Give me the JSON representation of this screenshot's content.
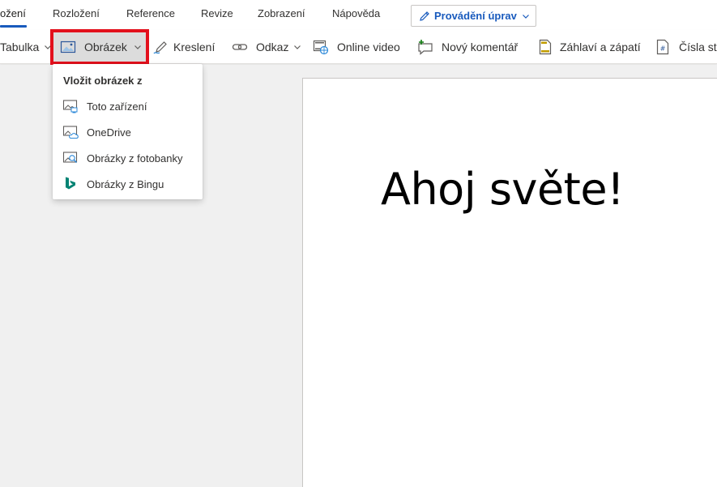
{
  "tabs": [
    {
      "label": "ožení"
    },
    {
      "label": "Rozložení"
    },
    {
      "label": "Reference"
    },
    {
      "label": "Revize"
    },
    {
      "label": "Zobrazení"
    },
    {
      "label": "Nápověda"
    }
  ],
  "edit_mode": {
    "label": "Provádění úprav"
  },
  "ribbon": {
    "tabulka": "Tabulka",
    "obrazek": "Obrázek",
    "kresleni": "Kreslení",
    "odkaz": "Odkaz",
    "online_video": "Online video",
    "novy_komentar": "Nový komentář",
    "zahlavi": "Záhlaví a zápatí",
    "cisla": "Čísla str"
  },
  "dropdown": {
    "header": "Vložit obrázek z",
    "items": [
      {
        "label": "Toto zařízení",
        "icon": "device-image-icon"
      },
      {
        "label": "OneDrive",
        "icon": "onedrive-image-icon"
      },
      {
        "label": "Obrázky z fotobanky",
        "icon": "stock-image-icon"
      },
      {
        "label": "Obrázky z Bingu",
        "icon": "bing-icon"
      }
    ]
  },
  "document": {
    "text": "Ahoj světe!"
  },
  "colors": {
    "accent": "#185abd",
    "highlight": "#e3101c",
    "bing": "#008373"
  }
}
